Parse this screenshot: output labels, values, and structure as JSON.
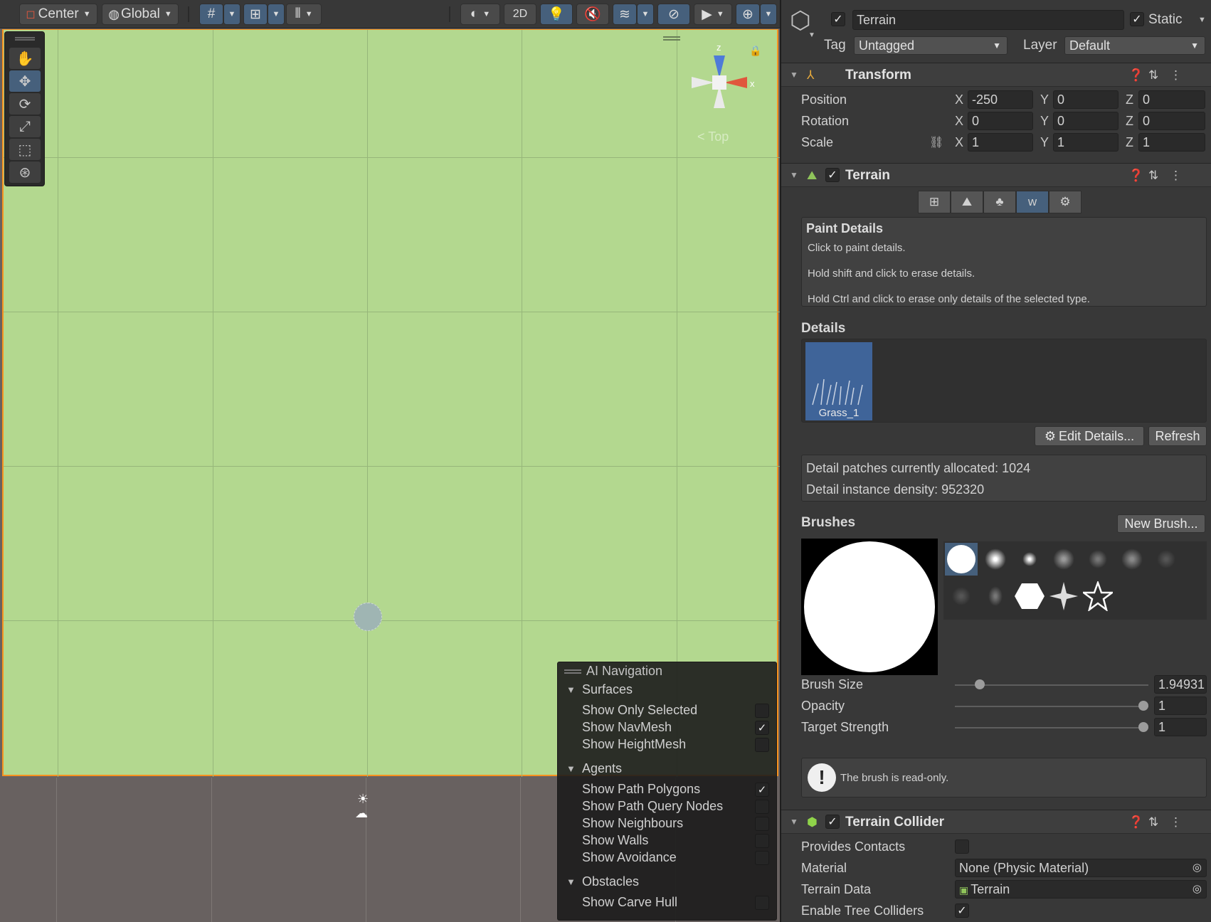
{
  "scene_toolbar": {
    "pivot_label": "Center",
    "space_label": "Global",
    "mode_2d_label": "2D"
  },
  "scene_view": {
    "gizmo_axes": {
      "x": "x",
      "z": "z"
    },
    "view_label": "Top",
    "terrain_color": "#b3d88f",
    "selection_outline_color": "#f7921e"
  },
  "ai_navigation": {
    "title": "AI Navigation",
    "surfaces": {
      "label": "Surfaces",
      "items": [
        {
          "label": "Show Only Selected",
          "checked": false
        },
        {
          "label": "Show NavMesh",
          "checked": true
        },
        {
          "label": "Show HeightMesh",
          "checked": false
        }
      ]
    },
    "agents": {
      "label": "Agents",
      "items": [
        {
          "label": "Show Path Polygons",
          "checked": true
        },
        {
          "label": "Show Path Query Nodes",
          "checked": false
        },
        {
          "label": "Show Neighbours",
          "checked": false
        },
        {
          "label": "Show Walls",
          "checked": false
        },
        {
          "label": "Show Avoidance",
          "checked": false
        }
      ]
    },
    "obstacles": {
      "label": "Obstacles",
      "items": [
        {
          "label": "Show Carve Hull",
          "checked": false
        }
      ]
    }
  },
  "inspector": {
    "object": {
      "name": "Terrain",
      "active": true,
      "static_label": "Static",
      "static": true,
      "tag_label": "Tag",
      "tag_value": "Untagged",
      "layer_label": "Layer",
      "layer_value": "Default"
    },
    "transform": {
      "title": "Transform",
      "rows": [
        {
          "label": "Position",
          "x": "-250",
          "y": "0",
          "z": "0"
        },
        {
          "label": "Rotation",
          "x": "0",
          "y": "0",
          "z": "0"
        },
        {
          "label": "Scale",
          "x": "1",
          "y": "1",
          "z": "1"
        }
      ],
      "axis_labels": {
        "x": "X",
        "y": "Y",
        "z": "Z"
      }
    },
    "terrain": {
      "title": "Terrain",
      "enabled": true,
      "paint_details": {
        "title": "Paint Details",
        "lines": [
          "Click to paint details.",
          "Hold shift and click to erase details.",
          "Hold Ctrl and click to erase only details of the selected type."
        ]
      },
      "details_label": "Details",
      "detail_item": "Grass_1",
      "edit_details_label": "Edit Details...",
      "refresh_label": "Refresh",
      "stats": {
        "patches": "Detail patches currently allocated: 1024",
        "density": "Detail instance density: 952320"
      },
      "brushes_label": "Brushes",
      "new_brush_label": "New Brush...",
      "brush_size_label": "Brush Size",
      "brush_size_value": "1.94931",
      "brush_size_fraction": 0.11,
      "opacity_label": "Opacity",
      "opacity_value": "1",
      "opacity_fraction": 1.0,
      "target_strength_label": "Target Strength",
      "target_strength_value": "1",
      "target_strength_fraction": 1.0,
      "read_only_message": "The brush is read-only."
    },
    "terrain_collider": {
      "title": "Terrain Collider",
      "enabled": true,
      "provides_contacts_label": "Provides Contacts",
      "provides_contacts": false,
      "material_label": "Material",
      "material_value": "None (Physic Material)",
      "terrain_data_label": "Terrain Data",
      "terrain_data_value": "Terrain",
      "enable_tree_colliders_label": "Enable Tree Colliders",
      "enable_tree_colliders": true
    }
  },
  "colors": {
    "accent_selected": "#46607c",
    "panel_bg": "#383838"
  }
}
